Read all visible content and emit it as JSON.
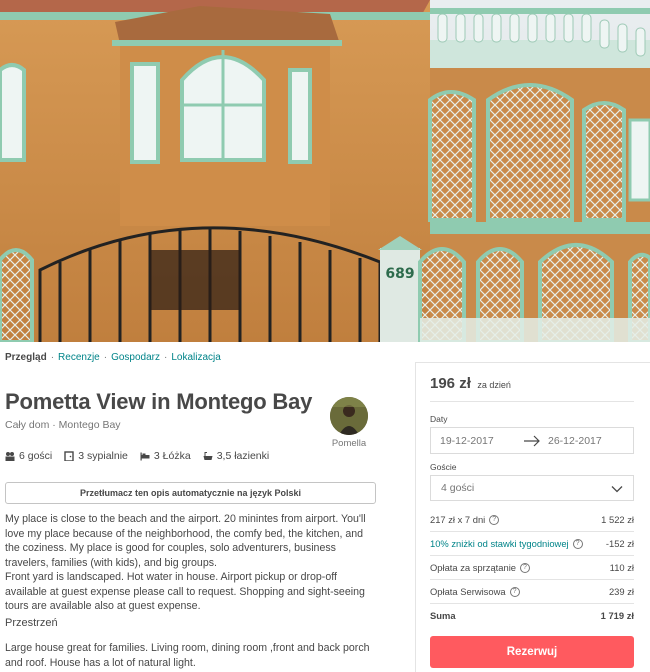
{
  "nav": {
    "items": [
      "Przegląd",
      "Recenzje",
      "Gospodarz",
      "Lokalizacja"
    ],
    "separator": "·"
  },
  "listing": {
    "title": "Pometta View in Montego Bay",
    "subtitle": "Cały dom · Montego Bay",
    "host_name": "Pomella",
    "amenities": [
      {
        "icon": "guests-icon",
        "label": "6 gości"
      },
      {
        "icon": "bedroom-icon",
        "label": "3 sypialnie"
      },
      {
        "icon": "bed-icon",
        "label": "3 Łóżka"
      },
      {
        "icon": "bath-icon",
        "label": "3,5 łazienki"
      }
    ],
    "translate_label": "Przetłumacz ten opis automatycznie na język Polski",
    "description": "My place is close to the beach and the airport. 20 minintes from airport. You'll love my place because of the neighborhood, the comfy bed, the kitchen, and the coziness. My place is good for couples, solo adventurers, business travelers, families (with kids), and big groups.\nFront yard is landscaped. Hot water in house. Airport pickup or drop-off available at guest expense please call to request. Shopping and sight-seeing tours are available also at guest expense.",
    "space_heading": "Przestrzeń",
    "space_text": "Large house great for families. Living room, dining room ,front and back porch and roof. House has a lot of natural light."
  },
  "booking": {
    "price": "196 zł",
    "per": "za dzień",
    "dates_label": "Daty",
    "checkin": "19-12-2017",
    "checkout": "26-12-2017",
    "guests_label": "Goście",
    "guests_value": "4 gości",
    "fees": [
      {
        "name": "217 zł x 7 dni",
        "amount": "1 522 zł",
        "help": true
      },
      {
        "name": "10% zniżki od stawki tygodniowej",
        "amount": "-152 zł",
        "help": true
      },
      {
        "name": "Opłata za sprzątanie",
        "amount": "110 zł",
        "help": true
      },
      {
        "name": "Opłata Serwisowa",
        "amount": "239 zł",
        "help": true
      },
      {
        "name": "Suma",
        "amount": "1 719 zł",
        "help": false
      }
    ],
    "book_label": "Rezerwuj",
    "accent": "#ff5a5f",
    "link_color": "#008489"
  },
  "hero": {
    "house_number": "689"
  }
}
